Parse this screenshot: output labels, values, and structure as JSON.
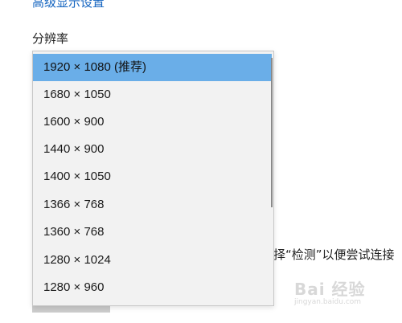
{
  "header": {
    "link_text": "高级显示设置"
  },
  "resolution": {
    "label": "分辨率",
    "selected_index": 0,
    "options": [
      "1920 × 1080 (推荐)",
      "1680 × 1050",
      "1600 × 900",
      "1440 × 900",
      "1400 × 1050",
      "1366 × 768",
      "1360 × 768",
      "1280 × 1024",
      "1280 × 960"
    ]
  },
  "background": {
    "partial_text": "择“检测”以便尝试连接"
  },
  "watermark": {
    "main": "Bai 经验",
    "sub": "jingyan.baidu.com"
  },
  "colors": {
    "selected_bg": "#6aaee8",
    "list_bg": "#f2f2f2",
    "link": "#1565c0"
  }
}
